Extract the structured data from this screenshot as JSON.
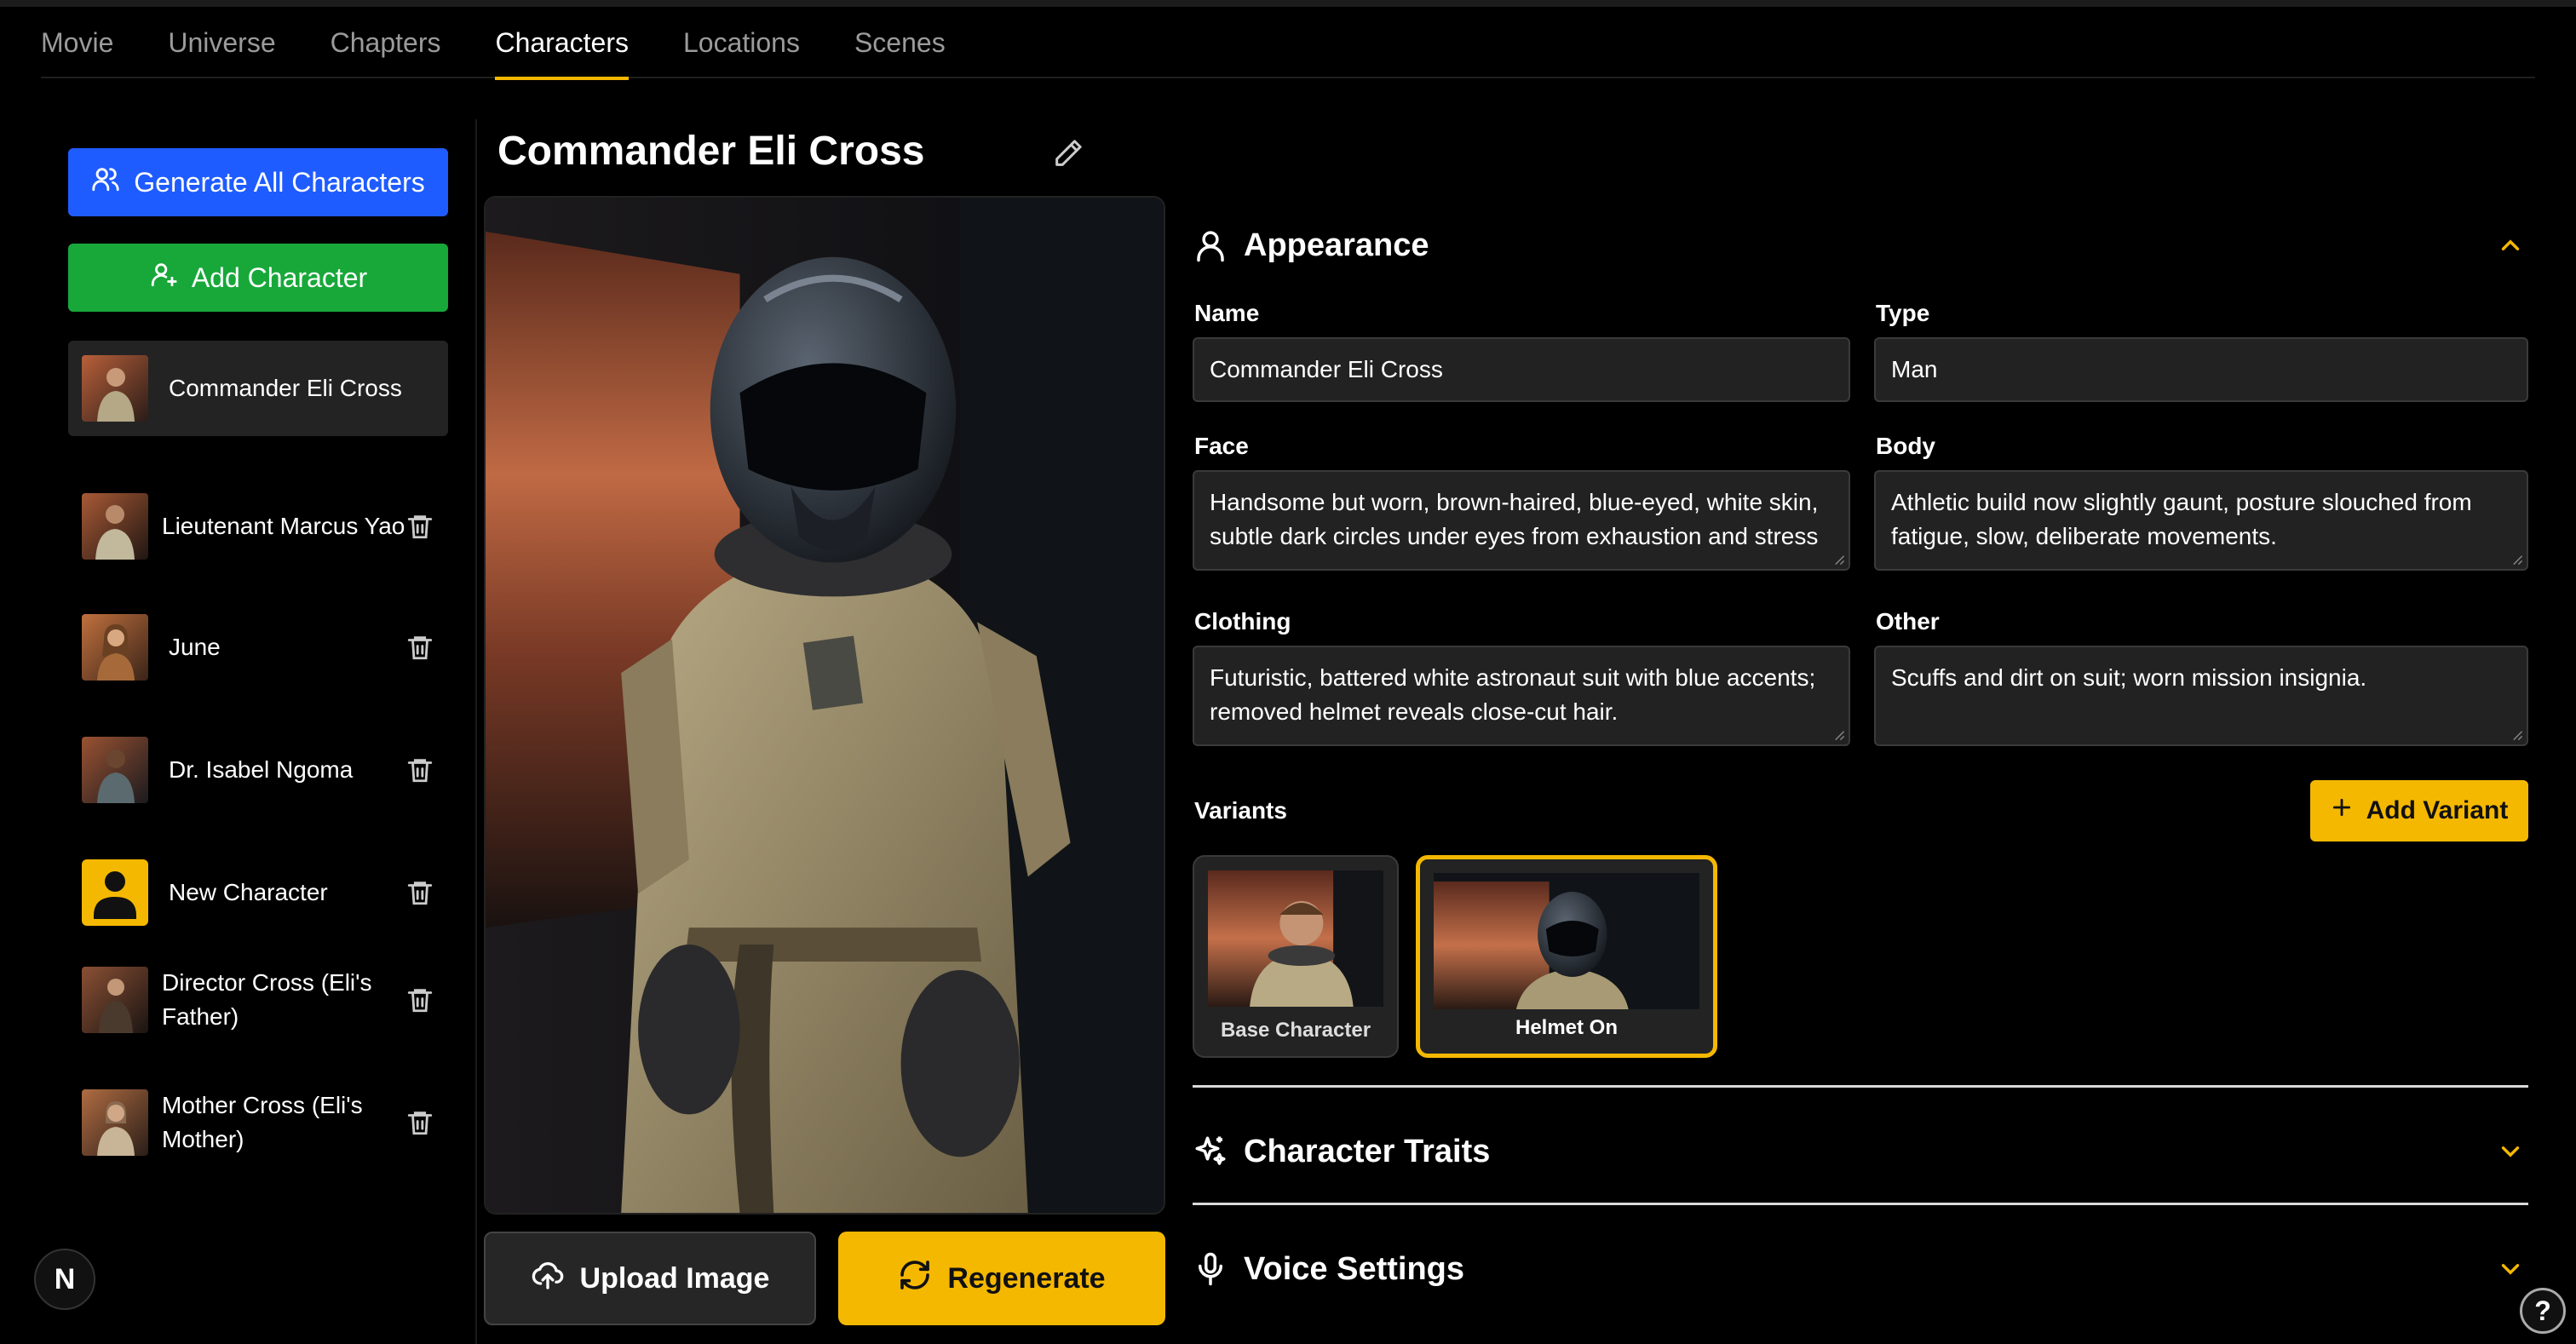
{
  "nav": {
    "tabs": [
      {
        "label": "Movie"
      },
      {
        "label": "Universe"
      },
      {
        "label": "Chapters"
      },
      {
        "label": "Characters",
        "active": true
      },
      {
        "label": "Locations"
      },
      {
        "label": "Scenes"
      }
    ]
  },
  "sidebar": {
    "generate_all_label": "Generate All Characters",
    "add_character_label": "Add Character",
    "characters": [
      {
        "name": "Commander Eli Cross",
        "active": true
      },
      {
        "name": "Lieutenant Marcus Yao"
      },
      {
        "name": "June"
      },
      {
        "name": "Dr. Isabel Ngoma"
      },
      {
        "name": "New Character",
        "placeholder_avatar": true
      },
      {
        "name": "Director Cross (Eli's Father)"
      },
      {
        "name": "Mother Cross (Eli's Mother)"
      }
    ],
    "logo_letter": "N"
  },
  "character": {
    "title": "Commander Eli Cross",
    "upload_label": "Upload Image",
    "regenerate_label": "Regenerate"
  },
  "appearance": {
    "section_title": "Appearance",
    "name_label": "Name",
    "name_value": "Commander Eli Cross",
    "type_label": "Type",
    "type_value": "Man",
    "face_label": "Face",
    "face_value": "Handsome but worn, brown-haired, blue-eyed, white skin, subtle dark circles under eyes from exhaustion and stress",
    "body_label": "Body",
    "body_value": "Athletic build now slightly gaunt, posture slouched from fatigue, slow, deliberate movements.",
    "clothing_label": "Clothing",
    "clothing_value": "Futuristic, battered white astronaut suit with blue accents; removed helmet reveals close-cut hair.",
    "other_label": "Other",
    "other_value": "Scuffs and dirt on suit; worn mission insignia.",
    "variants_label": "Variants",
    "add_variant_label": "Add Variant",
    "variants": [
      {
        "label": "Base Character"
      },
      {
        "label": "Helmet On",
        "selected": true
      }
    ]
  },
  "traits": {
    "section_title": "Character Traits"
  },
  "voice": {
    "section_title": "Voice Settings"
  },
  "help_label": "?",
  "colors": {
    "accent": "#f5b800",
    "generate_button": "#1f5cff",
    "add_button": "#18a83a",
    "background": "#000000"
  }
}
